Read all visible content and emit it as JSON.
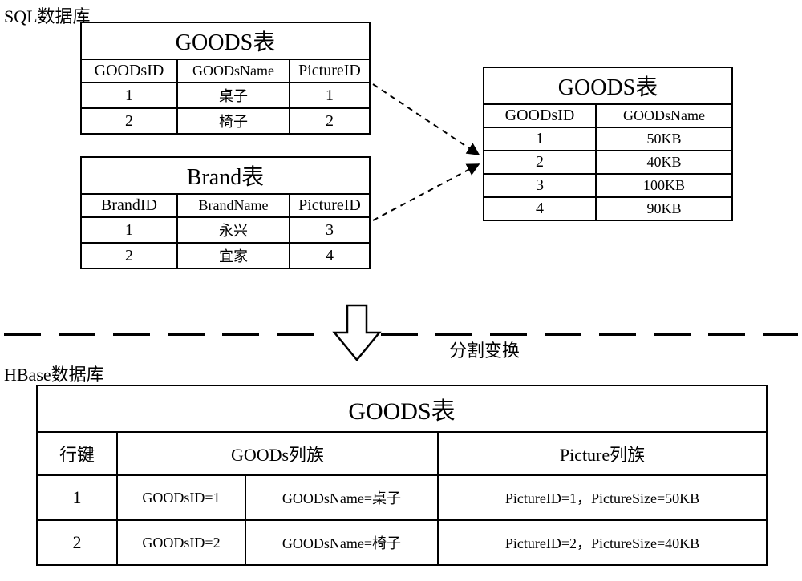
{
  "labels": {
    "sql_db": "SQL数据库",
    "hbase_db": "HBase数据库",
    "transform": "分割变换"
  },
  "goods_sql": {
    "title": "GOODS表",
    "headers": [
      "GOODsID",
      "GOODsName",
      "PictureID"
    ],
    "rows": [
      [
        "1",
        "桌子",
        "1"
      ],
      [
        "2",
        "椅子",
        "2"
      ]
    ]
  },
  "brand": {
    "title": "Brand表",
    "headers": [
      "BrandID",
      "BrandName",
      "PictureID"
    ],
    "rows": [
      [
        "1",
        "永兴",
        "3"
      ],
      [
        "2",
        "宜家",
        "4"
      ]
    ]
  },
  "picture": {
    "title": "GOODS表",
    "headers": [
      "GOODsID",
      "GOODsName"
    ],
    "rows": [
      [
        "1",
        "50KB"
      ],
      [
        "2",
        "40KB"
      ],
      [
        "3",
        "100KB"
      ],
      [
        "4",
        "90KB"
      ]
    ]
  },
  "hbase": {
    "title": "GOODS表",
    "group_headers": [
      "行键",
      "GOODs列族",
      "Picture列族"
    ],
    "rows": [
      [
        "1",
        "GOODsID=1",
        "GOODsName=桌子",
        "PictureID=1，PictureSize=50KB"
      ],
      [
        "2",
        "GOODsID=2",
        "GOODsName=椅子",
        "PictureID=2，PictureSize=40KB"
      ]
    ]
  }
}
